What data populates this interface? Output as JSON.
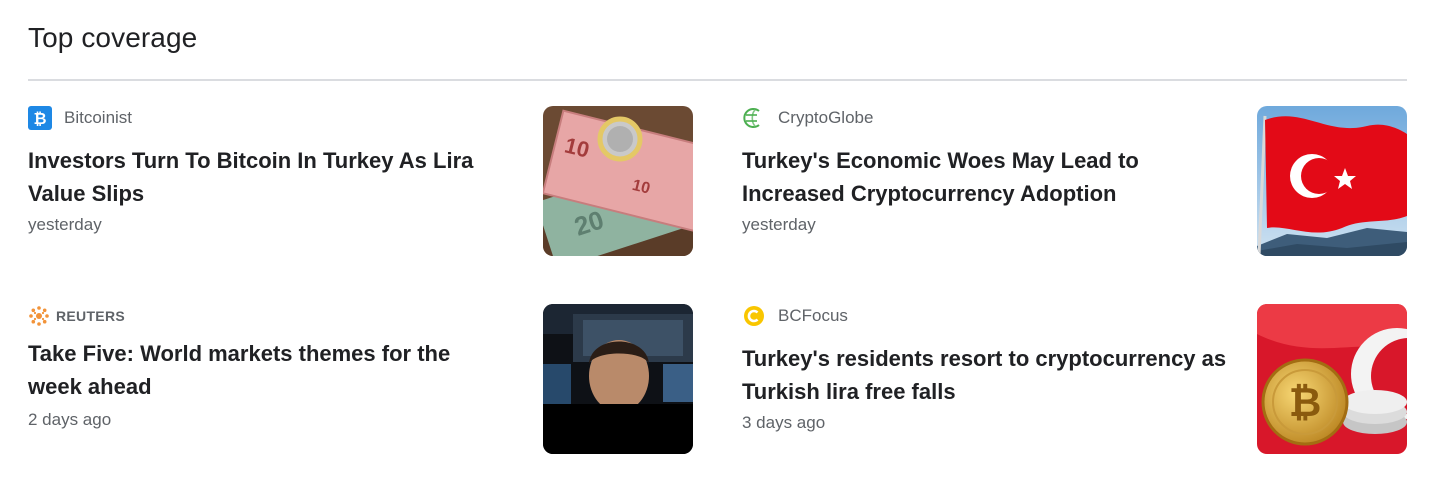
{
  "section": {
    "title": "Top coverage"
  },
  "articles": [
    {
      "source": "Bitcoinist",
      "headline": "Investors Turn To Bitcoin In Turkey As Lira Value Slips",
      "time": "yesterday",
      "logo_icon": "bitcoinist-logo-icon",
      "thumbnail": "lira-banknotes-and-coin-image"
    },
    {
      "source": "CryptoGlobe",
      "headline": "Turkey's Economic Woes May Lead to Increased Cryptocurrency Adoption",
      "time": "yesterday",
      "logo_icon": "cryptoglobe-logo-icon",
      "thumbnail": "turkish-flag-image"
    },
    {
      "source": "REUTERS",
      "headline": "Take Five: World markets themes for the week ahead",
      "time": "2 days ago",
      "logo_icon": "reuters-logo-icon",
      "thumbnail": "trader-at-screens-image"
    },
    {
      "source": "BCFocus",
      "headline": "Turkey's residents resort to cryptocurrency as Turkish lira free falls",
      "time": "3 days ago",
      "logo_icon": "bcfocus-logo-icon",
      "thumbnail": "bitcoin-coins-on-turkish-flag-image"
    }
  ],
  "colors": {
    "headline": "#202124",
    "meta": "#5f6368",
    "divider": "#dadce0",
    "bitcoinist_blue": "#1e88e5",
    "cryptoglobe_green": "#4caf50",
    "reuters_orange": "#f29339",
    "bcfocus_yellow": "#f9c600",
    "flag_red": "#e30a17"
  }
}
